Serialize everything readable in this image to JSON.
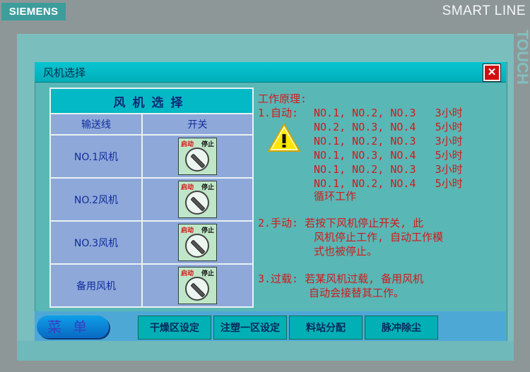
{
  "device": {
    "brand": "SIEMENS",
    "model": "SMART LINE",
    "side_text": "TOUCH"
  },
  "window": {
    "title": "风机选择",
    "close_icon": "close-x-icon"
  },
  "fan_table": {
    "header": "风机选择",
    "col_headers": [
      "输送线",
      "开关"
    ],
    "rows": [
      {
        "label": "NO.1风机"
      },
      {
        "label": "NO.2风机"
      },
      {
        "label": "NO.3风机"
      },
      {
        "label": "备用风机"
      }
    ],
    "switch_auto": "启动",
    "switch_stop": "停止"
  },
  "principle": {
    "title": "工作原理:",
    "auto_label": "1.自动:",
    "auto_lines": [
      "NO.1, NO.2, NO.3   3小时",
      "NO.2, NO.3, NO.4   5小时",
      "NO.1, NO.2, NO.3   3小时",
      "NO.1, NO.3, NO.4   5小时",
      "NO.1, NO.2, NO.3   3小时",
      "NO.1, NO.2, NO.4   5小时",
      "循环工作"
    ],
    "manual_1": "2.手动: 若按下风机停止开关, 此",
    "manual_2": "风机停止工作, 自动工作模",
    "manual_3": "式也被停止。",
    "overload_1": "3.过载: 若某风机过载, 备用风机",
    "overload_2": "自动会接替其工作。",
    "warning_icon": "warning-triangle-icon"
  },
  "footer": {
    "menu": "菜单",
    "nav": [
      "干燥区设定",
      "注塑一区设定",
      "料站分配",
      "脉冲除尘"
    ]
  },
  "colors": {
    "accent": "#00b0b5",
    "text_red": "#d11a1a",
    "table_bg": "#8fa8da"
  }
}
